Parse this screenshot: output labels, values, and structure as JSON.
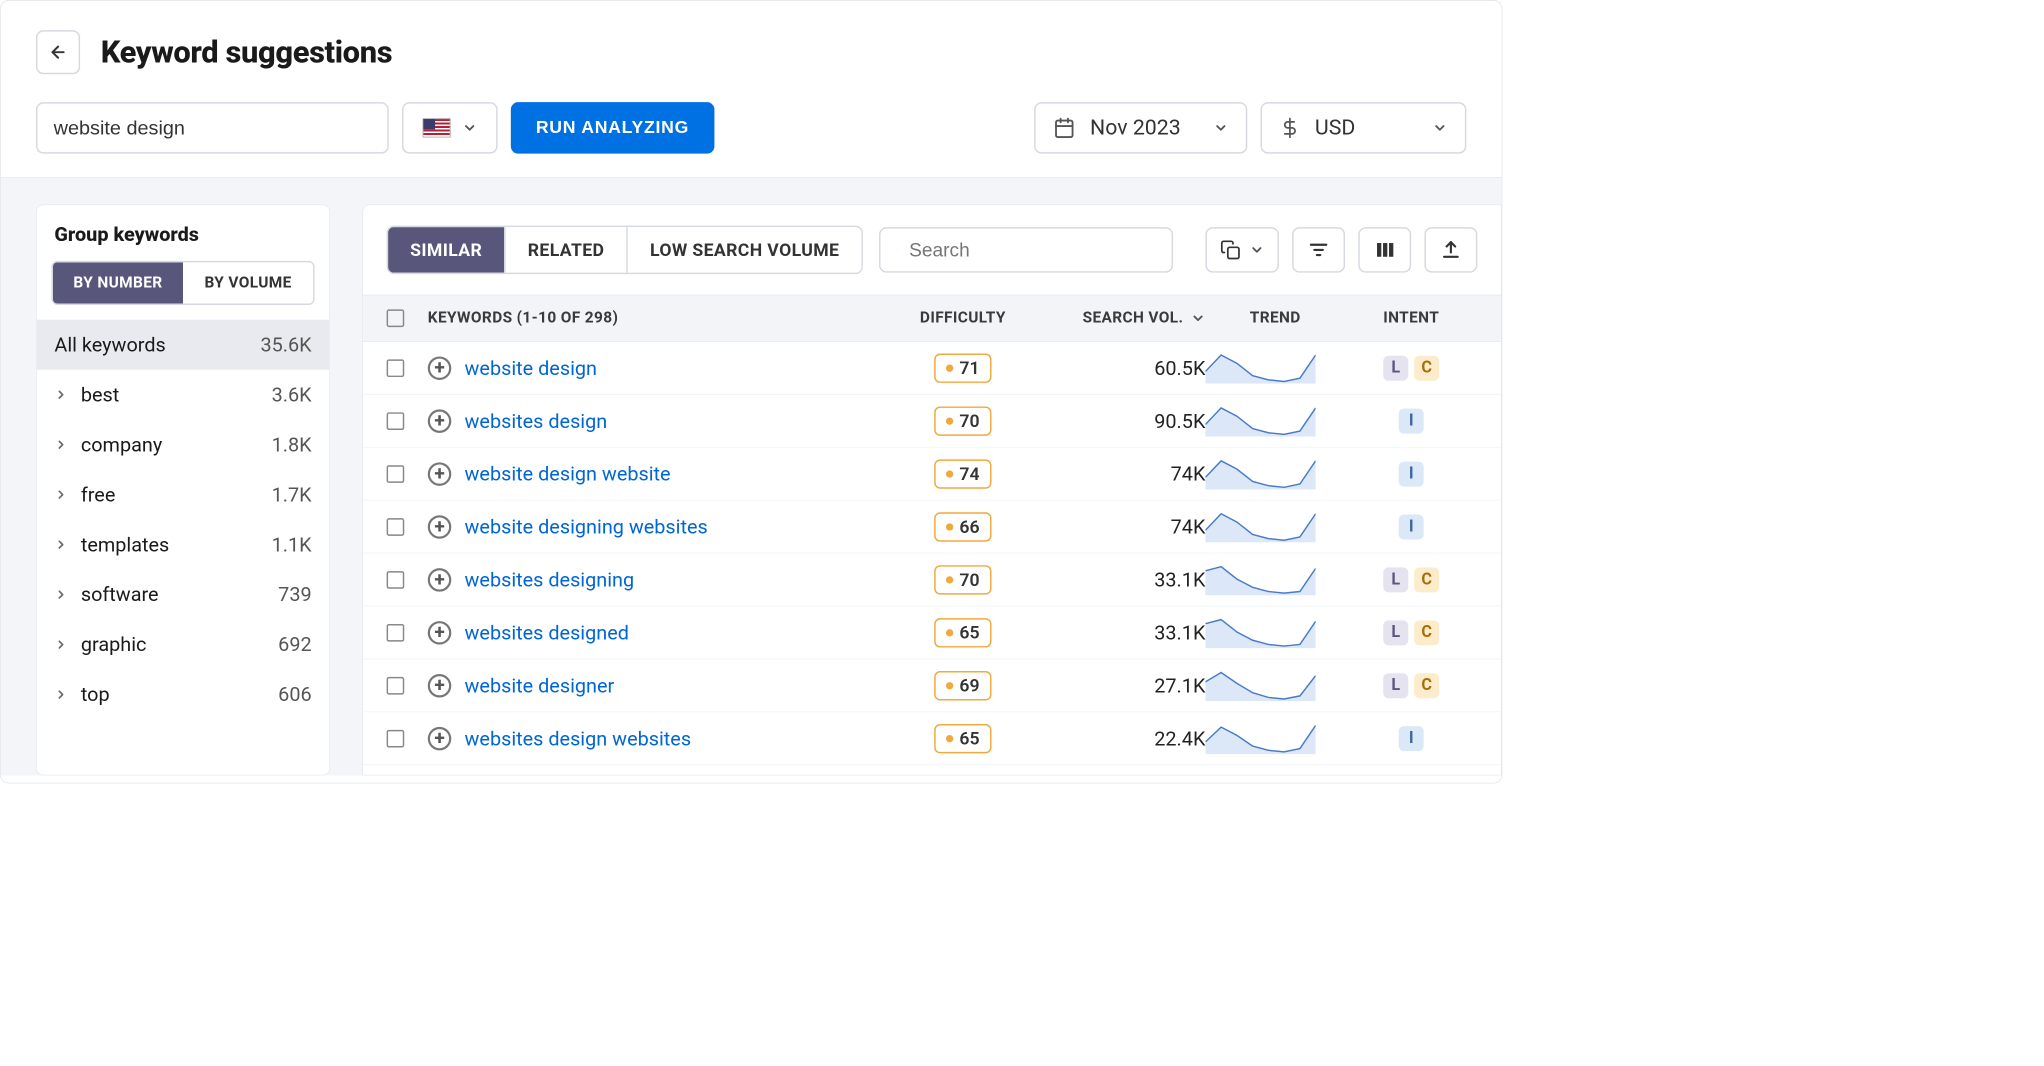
{
  "header": {
    "title": "Keyword suggestions",
    "keyword_input": "website design",
    "run_label": "RUN ANALYZING",
    "date_label": "Nov 2023",
    "currency_label": "USD"
  },
  "sidebar": {
    "title": "Group keywords",
    "toggle": {
      "by_number": "BY NUMBER",
      "by_volume": "BY VOLUME"
    },
    "all_label": "All keywords",
    "all_count": "35.6K",
    "groups": [
      {
        "label": "best",
        "count": "3.6K"
      },
      {
        "label": "company",
        "count": "1.8K"
      },
      {
        "label": "free",
        "count": "1.7K"
      },
      {
        "label": "templates",
        "count": "1.1K"
      },
      {
        "label": "software",
        "count": "739"
      },
      {
        "label": "graphic",
        "count": "692"
      },
      {
        "label": "top",
        "count": "606"
      }
    ]
  },
  "toolbar": {
    "tabs": {
      "similar": "SIMILAR",
      "related": "RELATED",
      "low": "LOW SEARCH VOLUME"
    },
    "search_placeholder": "Search"
  },
  "table": {
    "header": {
      "keywords": "KEYWORDS (1-10 OF 298)",
      "difficulty": "DIFFICULTY",
      "volume": "SEARCH VOL.",
      "trend": "TREND",
      "intent": "INTENT"
    },
    "rows": [
      {
        "keyword": "website design",
        "difficulty": "71",
        "volume": "60.5K",
        "intents": [
          "L",
          "C"
        ]
      },
      {
        "keyword": "websites design",
        "difficulty": "70",
        "volume": "90.5K",
        "intents": [
          "I"
        ]
      },
      {
        "keyword": "website design website",
        "difficulty": "74",
        "volume": "74K",
        "intents": [
          "I"
        ]
      },
      {
        "keyword": "website designing websites",
        "difficulty": "66",
        "volume": "74K",
        "intents": [
          "I"
        ]
      },
      {
        "keyword": "websites designing",
        "difficulty": "70",
        "volume": "33.1K",
        "intents": [
          "L",
          "C"
        ]
      },
      {
        "keyword": "websites designed",
        "difficulty": "65",
        "volume": "33.1K",
        "intents": [
          "L",
          "C"
        ]
      },
      {
        "keyword": "website designer",
        "difficulty": "69",
        "volume": "27.1K",
        "intents": [
          "L",
          "C"
        ]
      },
      {
        "keyword": "websites design websites",
        "difficulty": "65",
        "volume": "22.4K",
        "intents": [
          "I"
        ]
      }
    ]
  },
  "chart_data": {
    "type": "line",
    "note": "sparkline trend per row, approximate relative values",
    "series": [
      {
        "name": "website design",
        "values": [
          40,
          60,
          50,
          35,
          30,
          28,
          32,
          60
        ]
      },
      {
        "name": "websites design",
        "values": [
          40,
          60,
          50,
          35,
          30,
          28,
          32,
          60
        ]
      },
      {
        "name": "website design website",
        "values": [
          40,
          60,
          50,
          35,
          30,
          28,
          32,
          60
        ]
      },
      {
        "name": "website designing websites",
        "values": [
          40,
          60,
          50,
          35,
          30,
          28,
          32,
          60
        ]
      },
      {
        "name": "websites designing",
        "values": [
          55,
          60,
          45,
          35,
          30,
          28,
          30,
          58
        ]
      },
      {
        "name": "websites designed",
        "values": [
          55,
          60,
          45,
          35,
          30,
          28,
          30,
          58
        ]
      },
      {
        "name": "website designer",
        "values": [
          50,
          62,
          48,
          36,
          30,
          28,
          32,
          58
        ]
      },
      {
        "name": "websites design websites",
        "values": [
          40,
          58,
          48,
          35,
          30,
          28,
          32,
          60
        ]
      }
    ]
  }
}
